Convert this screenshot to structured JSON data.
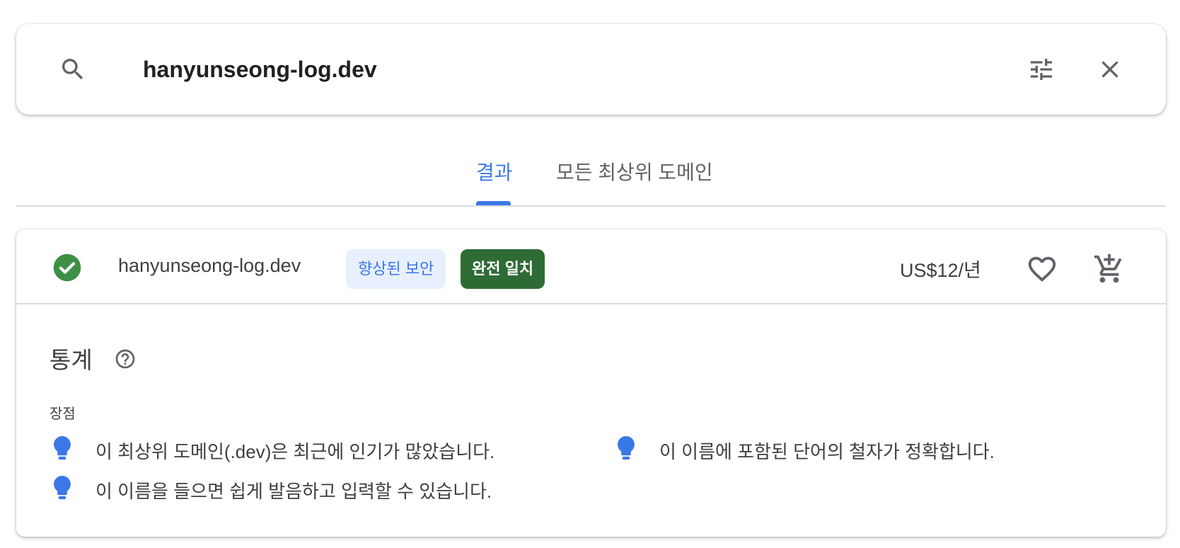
{
  "search": {
    "value": "hanyunseong-log.dev"
  },
  "tabs": [
    {
      "label": "결과",
      "active": true
    },
    {
      "label": "모든 최상위 도메인",
      "active": false
    }
  ],
  "result": {
    "domain": "hanyunseong-log.dev",
    "status_icon": "check-circle-icon",
    "badges": {
      "security": "향상된 보안",
      "exact_match": "완전 일치"
    },
    "price": "US$12/년"
  },
  "stats": {
    "heading": "통계",
    "pros_label": "장점",
    "pros": [
      "이 최상위 도메인(.dev)은 최근에 인기가 많았습니다.",
      "이 이름에 포함된 단어의 철자가 정확합니다.",
      "이 이름을 들으면 쉽게 발음하고 입력할 수 있습니다."
    ]
  },
  "colors": {
    "accent_blue": "#3b78e7",
    "success_green": "#3d8f46",
    "exact_badge_bg": "#2e6b35",
    "security_badge_bg": "#e8f0fe"
  }
}
